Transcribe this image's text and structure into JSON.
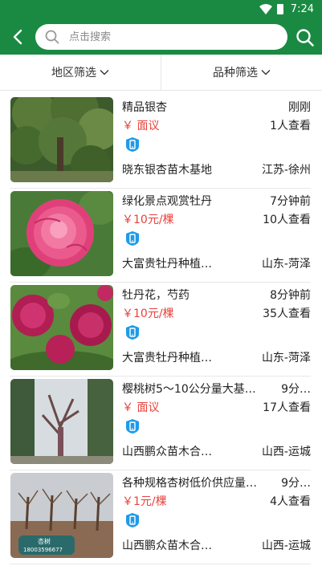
{
  "status_bar": {
    "time": "7:24"
  },
  "search": {
    "placeholder": "点击搜索"
  },
  "filters": {
    "region": "地区筛选",
    "variety": "品种筛选"
  },
  "colors": {
    "brand_green": "#1a8a43",
    "price_red": "#e8423c",
    "badge_blue": "#1e9be8"
  },
  "listings": [
    {
      "title": "精品银杏",
      "time": "刚刚",
      "price": "￥ 面议",
      "views": "1人查看",
      "seller": "晓东银杏苗木基地",
      "location": "江苏-徐州",
      "image": "ginkgo-tree-photo"
    },
    {
      "title": "绿化景点观赏牡丹",
      "time": "7分钟前",
      "price": "￥10元/棵",
      "views": "10人查看",
      "seller": "大富贵牡丹种植…",
      "location": "山东-菏泽",
      "image": "pink-peony-photo"
    },
    {
      "title": "牡丹花，芍药",
      "time": "8分钟前",
      "price": "￥10元/棵",
      "views": "35人查看",
      "seller": "大富贵牡丹种植…",
      "location": "山东-菏泽",
      "image": "red-peonies-photo"
    },
    {
      "title": "樱桃树5～10公分量大基…",
      "time": "9分…",
      "price": "￥ 面议",
      "views": "17人查看",
      "seller": "山西鹏众苗木合…",
      "location": "山西-运城",
      "image": "cherry-tree-photo"
    },
    {
      "title": "各种规格杏树低价供应量…",
      "time": "9分…",
      "price": "￥1元/棵",
      "views": "4人查看",
      "seller": "山西鹏众苗木合…",
      "location": "山西-运城",
      "image": "apricot-orchard-photo"
    }
  ],
  "watermark": {
    "text": "杏树",
    "phone": "18003596677"
  }
}
